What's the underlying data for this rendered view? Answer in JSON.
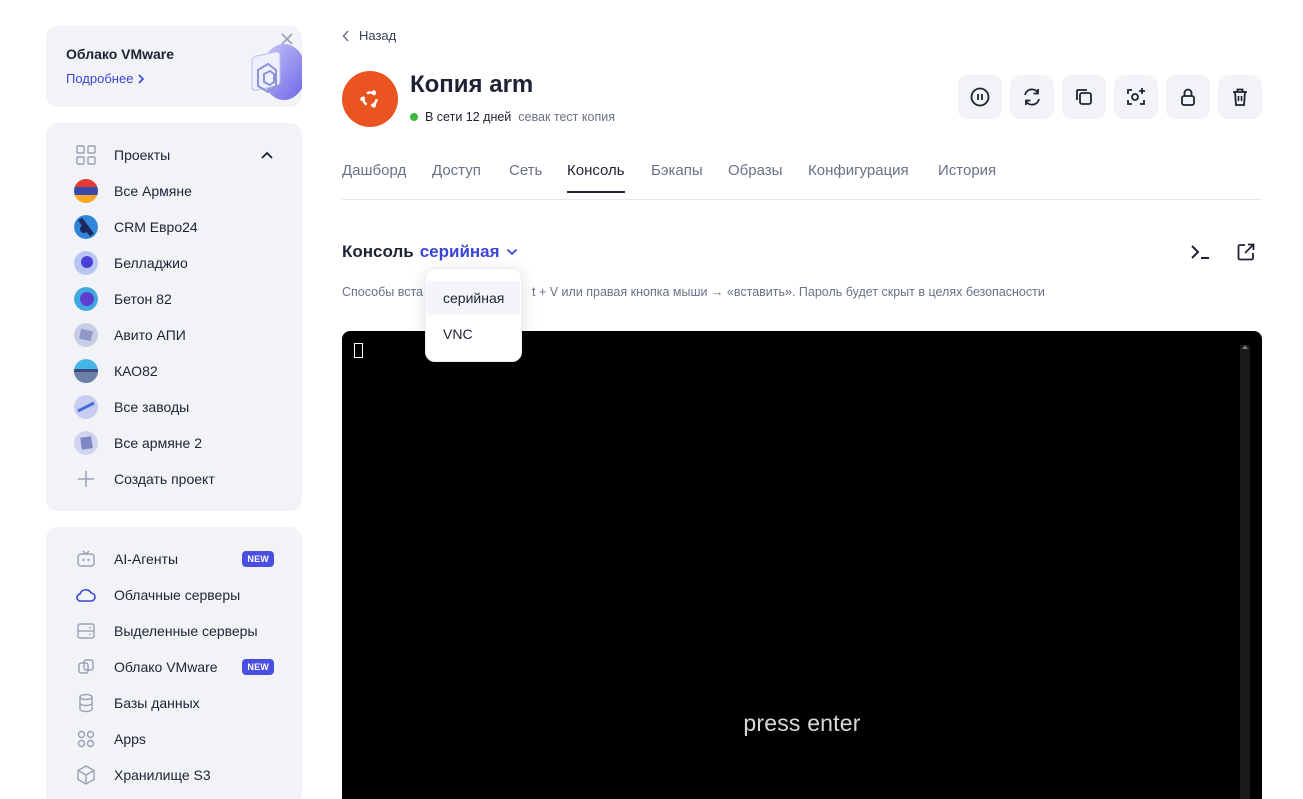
{
  "promo": {
    "title": "Облако VMware",
    "link": "Подробнее"
  },
  "projects": {
    "header": "Проекты",
    "items": [
      {
        "label": "Все Армяне"
      },
      {
        "label": "CRM Евро24"
      },
      {
        "label": "Белладжио"
      },
      {
        "label": "Бетон 82"
      },
      {
        "label": "Авито АПИ"
      },
      {
        "label": "КАО82"
      },
      {
        "label": "Все заводы"
      },
      {
        "label": "Все армяне 2"
      }
    ],
    "create": "Создать проект"
  },
  "services": {
    "items": [
      {
        "label": "AI-Агенты",
        "badge": "NEW"
      },
      {
        "label": "Облачные серверы"
      },
      {
        "label": "Выделенные серверы"
      },
      {
        "label": "Облако VMware",
        "badge": "NEW"
      },
      {
        "label": "Базы данных"
      },
      {
        "label": "Apps"
      },
      {
        "label": "Хранилище S3"
      }
    ]
  },
  "header": {
    "back": "Назад",
    "title": "Копия arm",
    "status": "В сети 12 дней",
    "description": "севак тест копия"
  },
  "tabs": [
    "Дашборд",
    "Доступ",
    "Сеть",
    "Консоль",
    "Бэкапы",
    "Образы",
    "Конфигурация",
    "История"
  ],
  "active_tab": "Консоль",
  "console": {
    "title": "Консоль",
    "mode": "серийная",
    "hint_left": "Способы вста",
    "hint_right": "t + V   или правая кнопка мыши → «вставить». Пароль будет скрыт в целях безопасности",
    "dropdown": [
      "серийная",
      "VNC"
    ],
    "terminal_text": "press enter"
  },
  "colors": {
    "accent": "#3c46d6",
    "ubuntu": "#e95420",
    "online": "#3cb93c",
    "badge": "#4b4fe0"
  }
}
